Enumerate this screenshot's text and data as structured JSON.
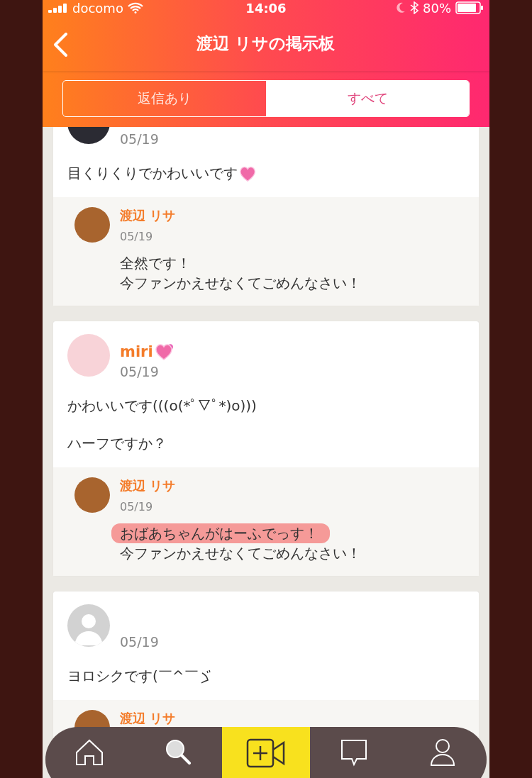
{
  "status_bar": {
    "carrier": "docomo",
    "time": "14:06",
    "battery": "80%"
  },
  "header": {
    "title": "渡辺 リサの掲示板"
  },
  "tabs": [
    {
      "label": "返信あり",
      "selected": false
    },
    {
      "label": "すべて",
      "selected": true
    }
  ],
  "posts": [
    {
      "avatar": {
        "kind": "photo"
      },
      "date": "05/19",
      "body": [
        {
          "kind": "heart-trail",
          "text": "目くりくりでかわいいです"
        }
      ],
      "reply": {
        "name": "渡辺 リサ",
        "date": "05/19",
        "lines": [
          {
            "text": "全然です！",
            "highlighted": false
          },
          {
            "text": "今ファンかえせなくてごめんなさい！",
            "highlighted": false
          }
        ]
      }
    },
    {
      "avatar": {
        "kind": "balloons"
      },
      "name": {
        "kind": "double-heart",
        "text": "miri"
      },
      "date": "05/19",
      "body": [
        {
          "kind": "plain",
          "text": "かわいいです(((o(*ﾟ▽ﾟ*)o)))"
        },
        {
          "kind": "plain",
          "text": "ハーフですか？"
        }
      ],
      "reply": {
        "name": "渡辺 リサ",
        "date": "05/19",
        "lines": [
          {
            "text": "おばあちゃんがはーふでっす！",
            "highlighted": true
          },
          {
            "text": "今ファンかえせなくてごめんなさい！",
            "highlighted": false
          }
        ]
      }
    },
    {
      "avatar": {
        "kind": "default"
      },
      "date": "05/19",
      "body": [
        {
          "kind": "salute-trail",
          "text": "ヨロシクです(￣^￣"
        }
      ],
      "reply": {
        "name": "渡辺 リサ"
      }
    }
  ],
  "nav": [
    {
      "kind": "home"
    },
    {
      "kind": "search"
    },
    {
      "kind": "video-add"
    },
    {
      "kind": "chat"
    },
    {
      "kind": "profile"
    }
  ]
}
